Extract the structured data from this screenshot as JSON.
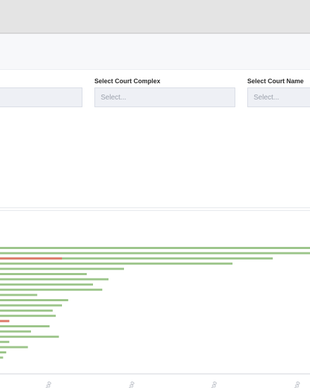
{
  "filters": {
    "court_complex": {
      "label": "Select Court Complex",
      "placeholder": "Select..."
    },
    "court_name": {
      "label": "Select Court Name",
      "placeholder": "Select..."
    }
  },
  "colors": {
    "green": "#9cc58a",
    "red": "#e07a6a",
    "select_bg": "#eef0f5"
  },
  "chart_data": {
    "type": "bar",
    "orientation": "horizontal",
    "series": [
      {
        "values": [
          100,
          100,
          88,
          75,
          40,
          28,
          35,
          30,
          33,
          12,
          22,
          20,
          17,
          18,
          3,
          16,
          10,
          19,
          3,
          9,
          2,
          1
        ]
      },
      {
        "values": [
          0,
          0,
          20,
          0,
          0,
          0,
          0,
          0,
          0,
          0,
          0,
          0,
          0,
          0,
          3,
          0,
          0,
          0,
          0,
          0,
          0,
          0
        ],
        "color": "red"
      }
    ],
    "x_tick_labels": [
      "200",
      "200",
      "200",
      "200"
    ],
    "grid": false
  }
}
